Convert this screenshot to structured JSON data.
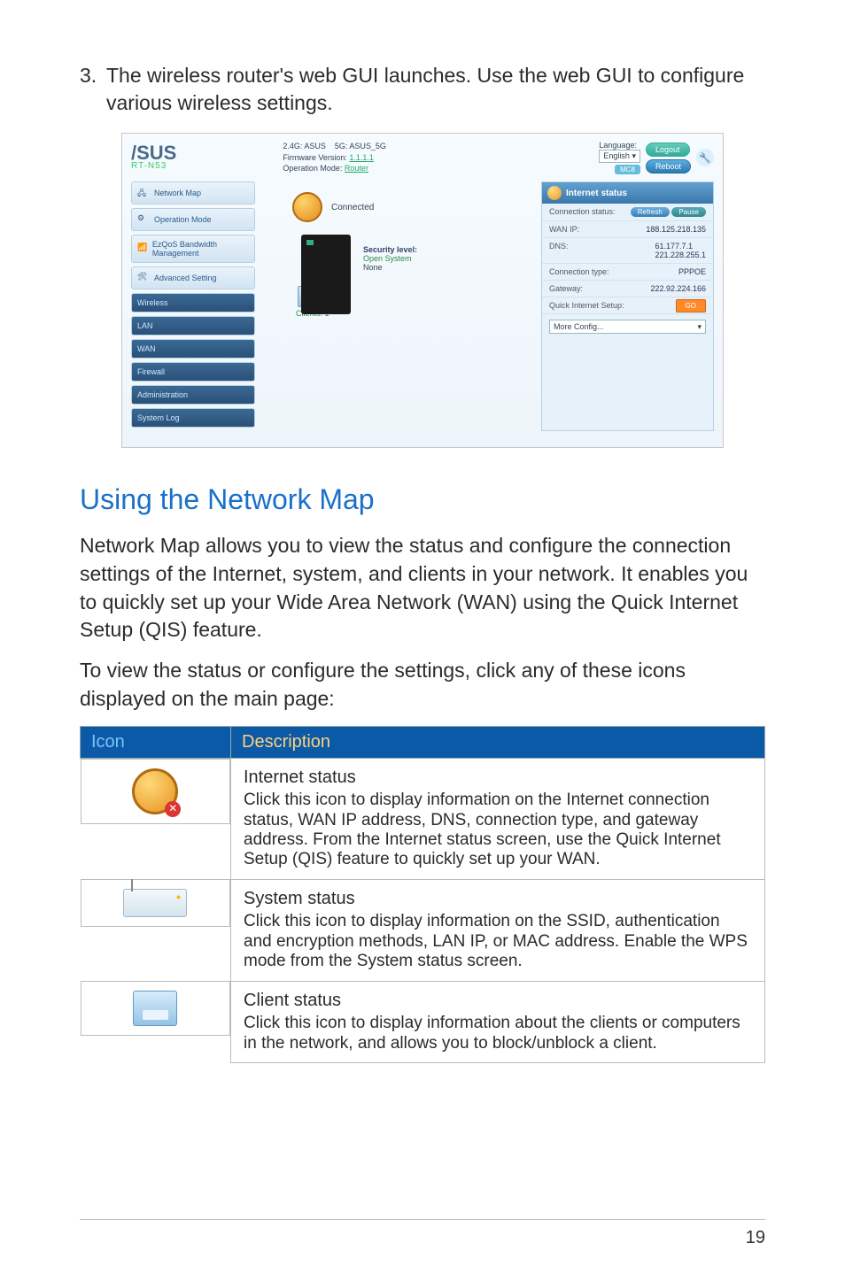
{
  "step_number": "3.",
  "step_text": "The wireless router's web GUI launches. Use the web GUI to configure various wireless settings.",
  "gui": {
    "logo_text": "/SUS",
    "model": "RT-N53",
    "ssid_24": "2.4G: ASUS",
    "ssid_5": "5G: ASUS_5G",
    "fw_label": "Firmware Version:",
    "fw_value": "1.1.1.1",
    "opmode_label": "Operation Mode:",
    "opmode_value": "Router",
    "lang_label": "Language:",
    "lang_value": "English",
    "logout": "Logout",
    "reboot": "Reboot",
    "mc_badge": "MC8",
    "sidebar": [
      "Network Map",
      "Operation Mode",
      "EzQoS Bandwidth Management",
      "Advanced Setting",
      "Wireless",
      "LAN",
      "WAN",
      "Firewall",
      "Administration",
      "System Log"
    ],
    "connected": "Connected",
    "security_label": "Security level:",
    "security_value": "Open System",
    "security_none": "None",
    "clients_label": "Clients:",
    "clients_value": "1",
    "rp_title": "Internet status",
    "rp_rows": {
      "conn_status_k": "Connection status:",
      "conn_status_refresh": "Refresh",
      "conn_status_pause": "Pause",
      "wan_ip_k": "WAN IP:",
      "wan_ip_v": "188.125.218.135",
      "dns_k": "DNS:",
      "dns_v1": "61.177.7.1",
      "dns_v2": "221.228.255.1",
      "conn_type_k": "Connection type:",
      "conn_type_v": "PPPOE",
      "gateway_k": "Gateway:",
      "gateway_v": "222.92.224.166",
      "qis_k": "Quick Internet Setup:",
      "qis_go": "GO",
      "more_config": "More Config..."
    }
  },
  "section_heading": "Using the Network Map",
  "para1": "Network Map allows you to view the status and configure the connection settings of the Internet, system, and clients in your network. It enables you to quickly set up your Wide Area Network (WAN) using the Quick Internet Setup (QIS) feature.",
  "para2": "To view the status or configure the settings, click any of these icons displayed on the main page:",
  "table": {
    "h_icon": "Icon",
    "h_desc": "Description",
    "rows": [
      {
        "title": "Internet status",
        "body": "Click this icon to display information on the Internet connection status, WAN IP address, DNS, connection type, and gateway address. From the Internet status screen, use the Quick Internet Setup (QIS) feature to quickly set up your WAN."
      },
      {
        "title": "System status",
        "body": "Click this icon to display information on the SSID, authentication and encryption methods, LAN IP, or MAC address. Enable the WPS mode from the System status screen."
      },
      {
        "title": "Client status",
        "body": "Click this icon to display information about the clients or computers in the network, and allows you to block/unblock a client."
      }
    ]
  },
  "page_number": "19"
}
